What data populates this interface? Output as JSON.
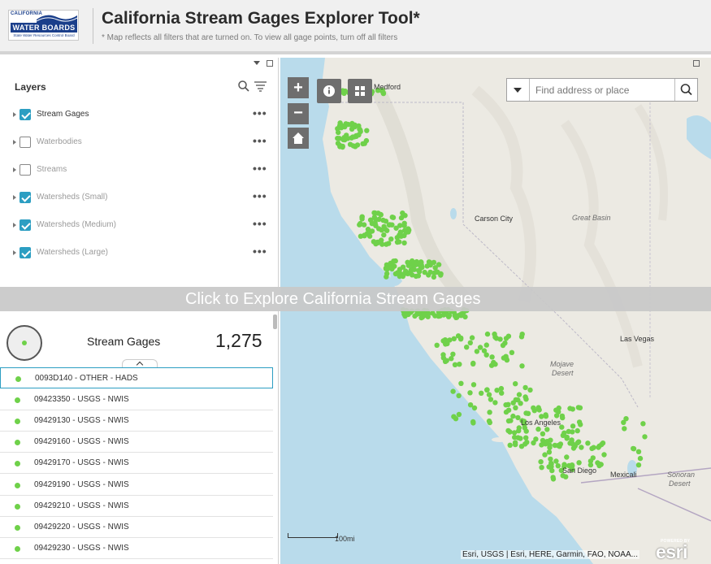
{
  "header": {
    "logo_top": "CALIFORNIA",
    "logo_main": "WATER BOARDS",
    "logo_sub": "State Water Resources Control Board",
    "title": "California Stream Gages Explorer Tool*",
    "subtitle": "* Map reflects all filters that are turned on. To view all gage points, turn off all filters"
  },
  "layers": {
    "title": "Layers",
    "items": [
      {
        "label": "Stream Gages",
        "checked": true
      },
      {
        "label": "Waterbodies",
        "checked": false
      },
      {
        "label": "Streams",
        "checked": false
      },
      {
        "label": "Watersheds (Small)",
        "checked": true
      },
      {
        "label": "Watersheds (Medium)",
        "checked": true
      },
      {
        "label": "Watersheds (Large)",
        "checked": true
      }
    ]
  },
  "banner": {
    "text": "Click to Explore California Stream Gages"
  },
  "list": {
    "summary_name": "Stream Gages",
    "summary_count": "1,275",
    "rows": [
      "0093D140 - OTHER - HADS",
      "09423350 - USGS - NWIS",
      "09429130 - USGS - NWIS",
      "09429160 - USGS - NWIS",
      "09429170 - USGS - NWIS",
      "09429190 - USGS - NWIS",
      "09429210 - USGS - NWIS",
      "09429220 - USGS - NWIS",
      "09429230 - USGS - NWIS"
    ]
  },
  "map": {
    "search_placeholder": "Find address or place",
    "labels": {
      "medford": "Medford",
      "carson_city": "Carson City",
      "great_basin": "Great Basin",
      "las_vegas": "Las Vegas",
      "mojave": "Mojave",
      "desert": "Desert",
      "los_angeles": "Los Angeles",
      "san_diego": "San Diego",
      "mexicali": "Mexicali",
      "sonoran": "Sonoran",
      "sonoran_desert": "Desert"
    },
    "scale_label": "100mi",
    "attribution": "Esri, USGS | Esri, HERE, Garmin, FAO, NOAA...",
    "esri_powered": "POWERED BY",
    "esri_word": "esri",
    "gage_color": "#6fd14a",
    "ocean_color": "#b9dbeb",
    "land_color": "#eceae3"
  },
  "colors": {
    "accent": "#2c9ec2",
    "brand": "#1b3f8b"
  }
}
